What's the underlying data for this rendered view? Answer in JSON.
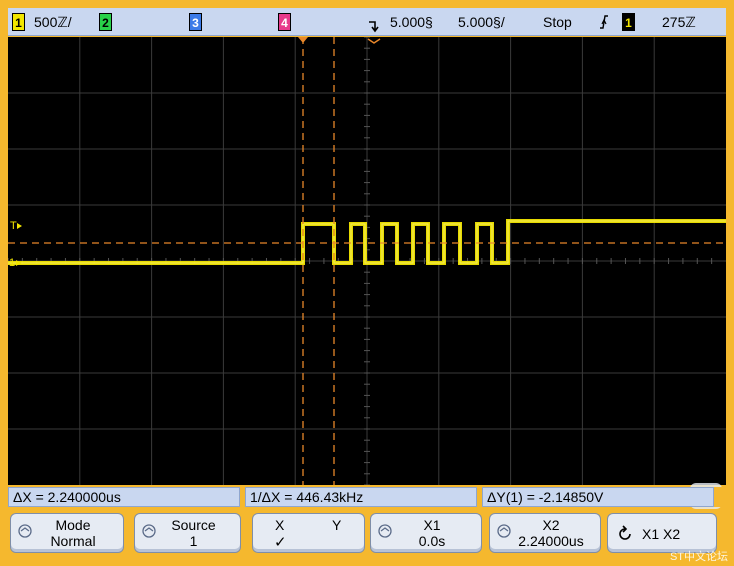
{
  "topbar": {
    "ch1_num": "1",
    "ch1_scale": "500ℤ/",
    "ch2_num": "2",
    "ch3_num": "3",
    "ch4_num": "4",
    "trig_icon": "falling-edge-icon",
    "time_delay": "5.000§",
    "time_scale": "5.000§/",
    "run_state": "Stop",
    "trig_slope_icon": "slope-icon",
    "trig_source_num": "1",
    "trig_level": "275ℤ"
  },
  "measure": {
    "delta_x": "ΔX = 2.240000us",
    "inv_delta_x": "1/ΔX = 446.43kHz",
    "delta_y": "ΔY(1) = -2.14850V"
  },
  "softkeys": {
    "mode_label": "Mode",
    "mode_value": "Normal",
    "source_label": "Source",
    "source_value": "1",
    "x_label": "X",
    "y_label": "Y",
    "x_check": "✓",
    "x1_label": "X1",
    "x1_value": "0.0s",
    "x2_label": "X2",
    "x2_value": "2.24000us",
    "x1x2_label": "X1 X2"
  },
  "screen": {
    "ground_marker": "1",
    "trigger_marker": "T"
  },
  "watermark": "ST中文论坛",
  "colors": {
    "frame": "#f5b82e",
    "trace": "#f2e600",
    "cursor": "#e8872a",
    "bar": "#c9d7f0"
  }
}
